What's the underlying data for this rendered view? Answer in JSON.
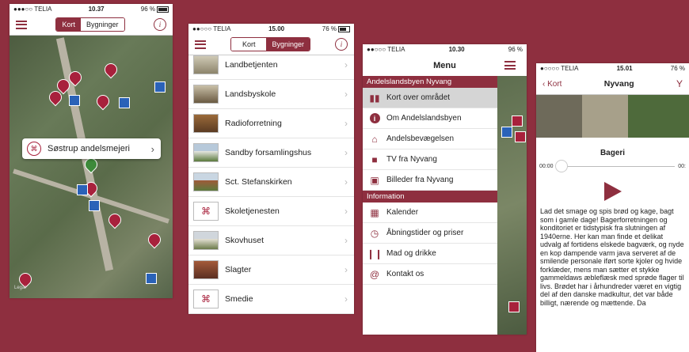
{
  "status": {
    "p1": {
      "carrier": "●●●○○ TELIA",
      "time": "10.37",
      "battery": "96 %"
    },
    "p2": {
      "carrier": "●●○○○ TELIA",
      "time": "15.00",
      "battery": "76 %"
    },
    "p3": {
      "carrier": "●●○○○ TELIA",
      "time": "10.30",
      "battery": "96 %"
    },
    "p4": {
      "carrier": "●○○○○ TELIA",
      "time": "15.01",
      "battery": "76 %"
    }
  },
  "segment": {
    "map": "Kort",
    "buildings": "Bygninger"
  },
  "map": {
    "callout": "Søstrup andelsmejeri",
    "legal": "Legal"
  },
  "list": [
    {
      "label": "Landbetjenten"
    },
    {
      "label": "Landsbyskole"
    },
    {
      "label": "Radioforretning"
    },
    {
      "label": "Sandby forsamlingshus"
    },
    {
      "label": "Sct. Stefanskirken"
    },
    {
      "label": "Skoletjenesten"
    },
    {
      "label": "Skovhuset"
    },
    {
      "label": "Slagter"
    },
    {
      "label": "Smedie"
    }
  ],
  "menu": {
    "title": "Menu",
    "section1": "Andelslandsbyen Nyvang",
    "items1": [
      "Kort over området",
      "Om Andelslandsbyen",
      "Andelsbevægelsen",
      "TV fra Nyvang",
      "Billeder fra Nyvang"
    ],
    "section2": "Information",
    "items2": [
      "Kalender",
      "Åbningstider og priser",
      "Mad og drikke",
      "Kontakt os"
    ]
  },
  "detail": {
    "back": "Kort",
    "title": "Nyvang",
    "subtitle": "Bageri",
    "time_start": "00:00",
    "time_end": "00:",
    "text": "Lad det smage og spis brød og kage, bagt som i gamle dage! Bagerforretningen og konditoriet er tidstypisk fra slutningen af 1940erne. Her kan man finde et delikat udvalg af fortidens elskede bagværk, og nyde en kop dampende varm java serveret af de smilende personale iført sorte kjoler og hvide forklæder, mens man sætter et stykke gammeldaws æbleflæsk med sprøde flager til livs. Brødet har i århundreder været en vigtig del af den danske madkultur, det var både billigt, nærende og mættende. Da"
  }
}
